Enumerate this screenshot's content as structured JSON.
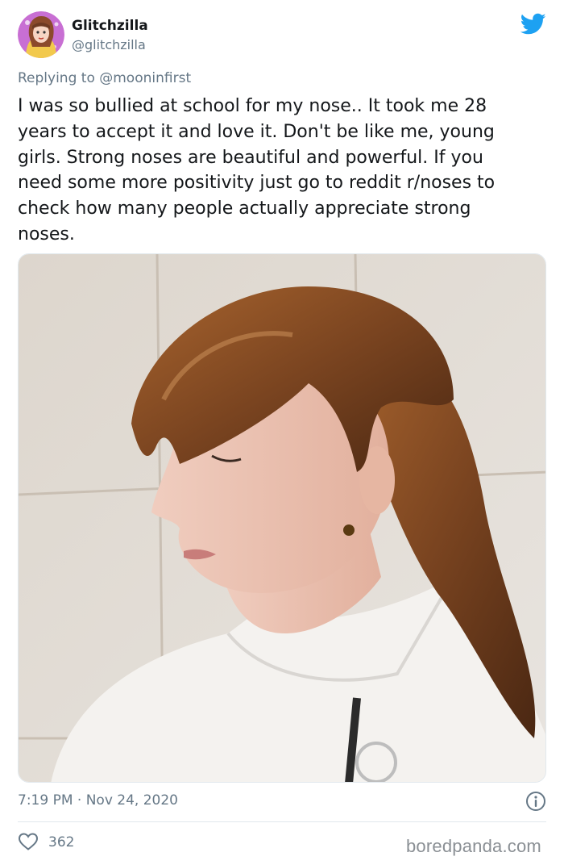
{
  "author": {
    "display_name": "Glitchzilla",
    "handle": "@glitchzilla",
    "avatar_icon": "cartoon-avatar-icon"
  },
  "brand_icon": "twitter-bird-icon",
  "brand_color": "#1da1f2",
  "reply": {
    "prefix": "Replying to",
    "handle": "@mooninfirst"
  },
  "tweet": {
    "lines": [
      "I was so bullied at school for my nose.. It took me 28",
      "years to accept it and love it. Don't be like me, young",
      "girls. Strong noses are beautiful and powerful. If you",
      "need some more positivity just go to reddit r/noses to",
      "check how many people actually appreciate strong",
      "noses."
    ]
  },
  "photo": {
    "subject": "profile-selfie"
  },
  "meta": {
    "timestamp": "7:19 PM · Nov 24, 2020",
    "info_icon": "info-icon"
  },
  "stats": {
    "likes": "362",
    "like_icon": "heart-icon"
  },
  "watermark": "boredpanda.com"
}
